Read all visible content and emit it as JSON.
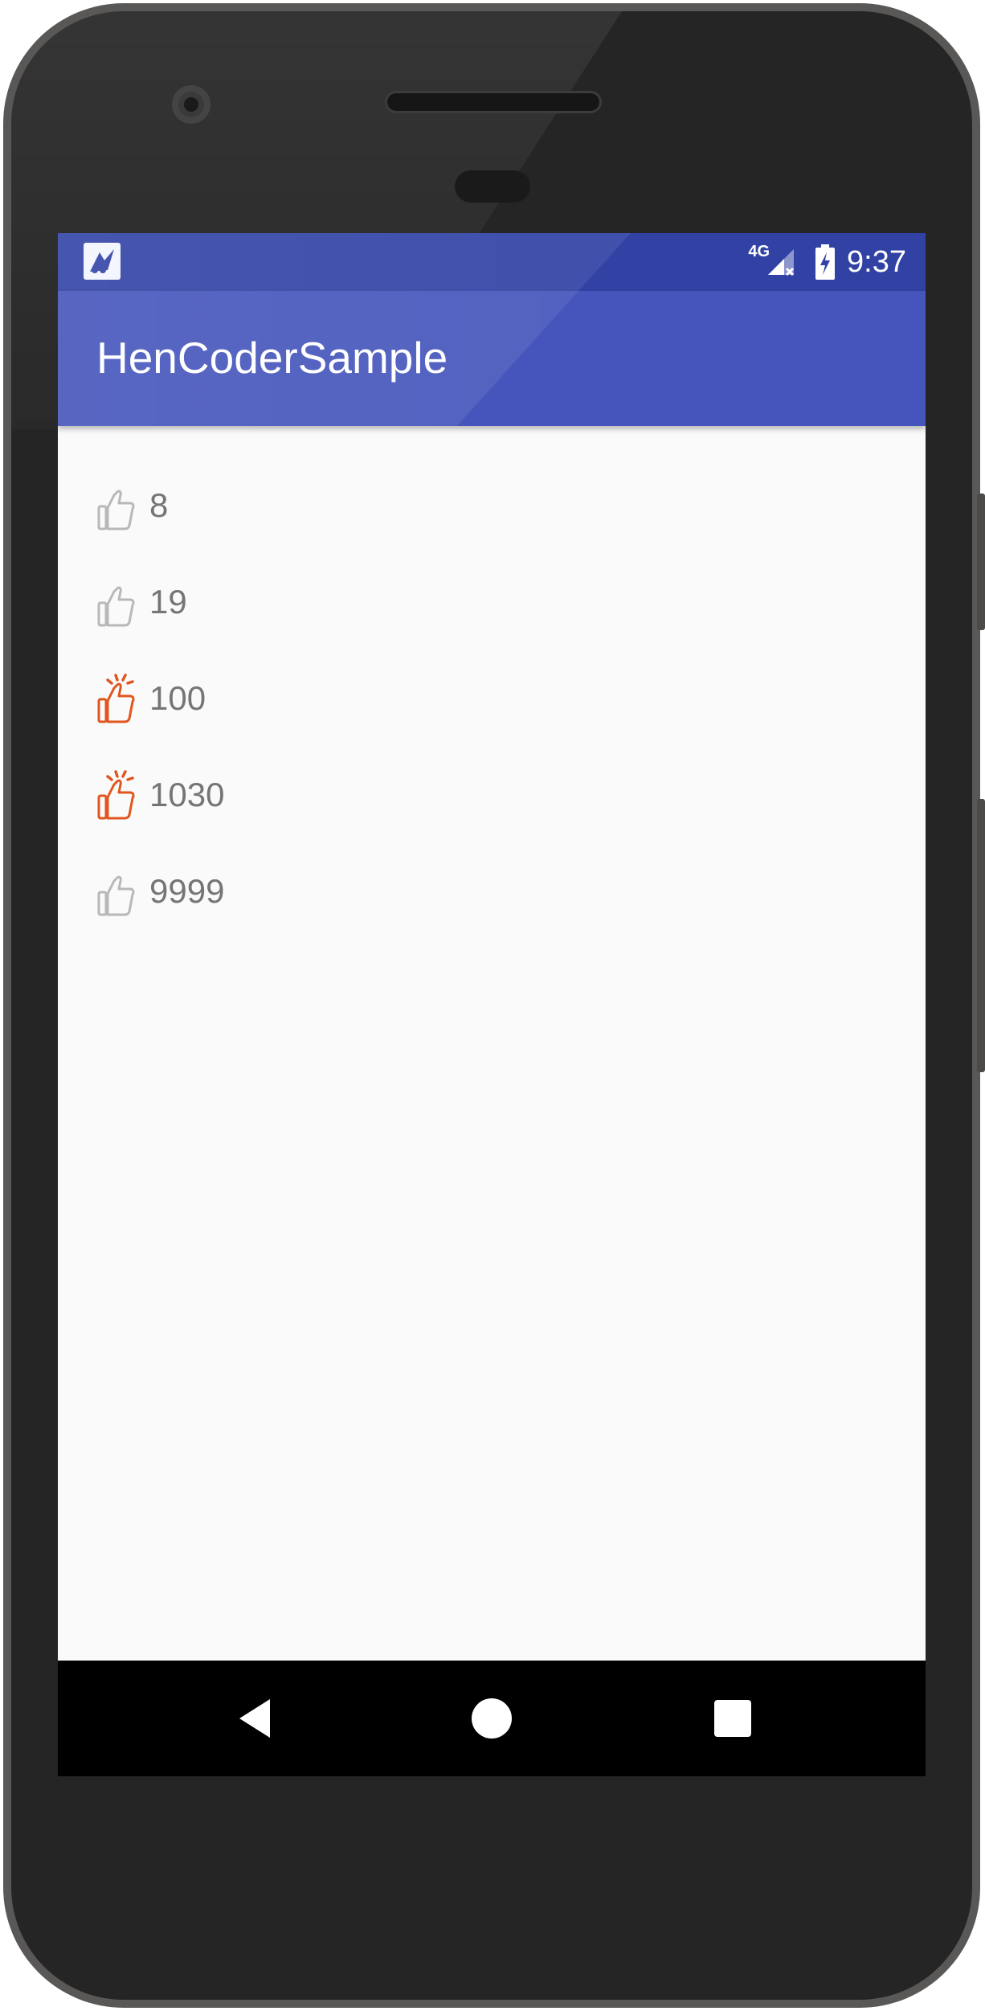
{
  "status_bar": {
    "network": "4G",
    "time": "9:37"
  },
  "app_bar": {
    "title": "HenCoderSample"
  },
  "likes": [
    {
      "count": "8",
      "liked": false
    },
    {
      "count": "19",
      "liked": false
    },
    {
      "count": "100",
      "liked": true
    },
    {
      "count": "1030",
      "liked": true
    },
    {
      "count": "9999",
      "liked": false
    }
  ],
  "colors": {
    "primary": "#4555bb",
    "primary_dark": "#3142a4",
    "liked": "#e0561e",
    "unliked": "#b8b8b8",
    "count_text": "#757575"
  },
  "icons": {
    "like": "thumbs-up-icon",
    "liked": "thumbs-up-sparkle-icon",
    "back": "back-triangle-icon",
    "home": "home-circle-icon",
    "recents": "recents-square-icon"
  }
}
